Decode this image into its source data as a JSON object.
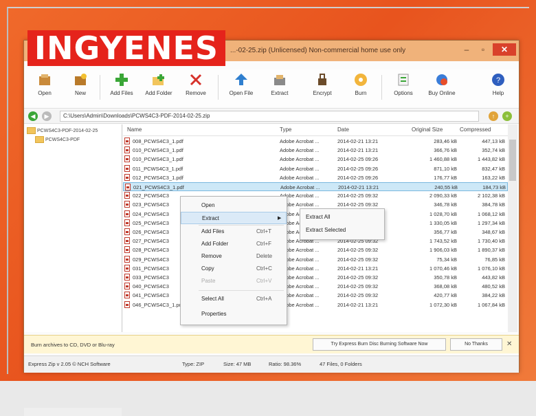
{
  "banner": {
    "text": "INGYENES",
    "color": "#e5231b"
  },
  "window": {
    "title": "...-02-25.zip (Unlicensed) Non-commercial home use only",
    "controls": {
      "minimize": "–",
      "maximize": "▫",
      "close": "✕"
    }
  },
  "toolbar": {
    "buttons": [
      {
        "label": "Open",
        "icon": "open-archive-icon"
      },
      {
        "label": "New",
        "icon": "new-archive-icon"
      },
      {
        "label": "Add Files",
        "icon": "add-files-icon"
      },
      {
        "label": "Add Folder",
        "icon": "add-folder-icon"
      },
      {
        "label": "Remove",
        "icon": "remove-icon"
      },
      {
        "label": "Open File",
        "icon": "open-file-icon"
      },
      {
        "label": "Extract",
        "icon": "extract-icon"
      },
      {
        "label": "Encrypt",
        "icon": "encrypt-icon"
      },
      {
        "label": "Burn",
        "icon": "burn-icon"
      },
      {
        "label": "Options",
        "icon": "options-icon"
      },
      {
        "label": "Buy Online",
        "icon": "buy-online-icon"
      },
      {
        "label": "Help",
        "icon": "help-icon"
      }
    ]
  },
  "address": {
    "path": "C:\\Users\\Admin\\Downloads\\PCWS4C3-PDF-2014-02-25.zip"
  },
  "tree": {
    "items": [
      {
        "label": "PCWS4C3-PDF-2014-02-25"
      },
      {
        "label": "PCWS4C3-PDF"
      }
    ]
  },
  "filelist": {
    "columns": {
      "name": "Name",
      "type": "Type",
      "date": "Date",
      "original": "Original Size",
      "compressed": "Compressed"
    },
    "rows": [
      {
        "name": "008_PCWS4C3_1.pdf",
        "type": "Adobe Acrobat ...",
        "date": "2014-02-21 13:21",
        "original": "283,46 kB",
        "compressed": "447,13 kB"
      },
      {
        "name": "010_PCWS4C3_1.pdf",
        "type": "Adobe Acrobat ...",
        "date": "2014-02-21 13:21",
        "original": "366,76 kB",
        "compressed": "352,74 kB"
      },
      {
        "name": "010_PCWS4C3_1.pdf",
        "type": "Adobe Acrobat ...",
        "date": "2014-02-25 09:26",
        "original": "1 460,88 kB",
        "compressed": "1 443,82 kB"
      },
      {
        "name": "011_PCWS4C3_1.pdf",
        "type": "Adobe Acrobat ...",
        "date": "2014-02-25 09:26",
        "original": "871,10 kB",
        "compressed": "832,47 kB"
      },
      {
        "name": "012_PCWS4C3_1.pdf",
        "type": "Adobe Acrobat ...",
        "date": "2014-02-25 09:26",
        "original": "176,77 kB",
        "compressed": "163,22 kB"
      },
      {
        "name": "021_PCWS4C3_1.pdf",
        "type": "Adobe Acrobat ...",
        "date": "2014-02-21 13:21",
        "original": "240,55 kB",
        "compressed": "184,73 kB",
        "selected": true
      },
      {
        "name": "022_PCWS4C3",
        "type": "Adobe Acrobat ...",
        "date": "2014-02-25 09:32",
        "original": "2 090,33 kB",
        "compressed": "2 102,38 kB"
      },
      {
        "name": "023_PCWS4C3",
        "type": "Adobe Acrobat ...",
        "date": "2014-02-25 09:32",
        "original": "346,78 kB",
        "compressed": "384,78 kB"
      },
      {
        "name": "024_PCWS4C3",
        "type": "Adobe Acrobat ...",
        "date": "2014-02-25 09:32",
        "original": "1 028,70 kB",
        "compressed": "1 068,12 kB"
      },
      {
        "name": "025_PCWS4C3",
        "type": "Adobe Acrobat ...",
        "date": "2014-02-21 13:21",
        "original": "1 330,05 kB",
        "compressed": "1 297,34 kB"
      },
      {
        "name": "026_PCWS4C3",
        "type": "Adobe Acrobat ...",
        "date": "2014-02-25 09:32",
        "original": "356,77 kB",
        "compressed": "348,67 kB"
      },
      {
        "name": "027_PCWS4C3",
        "type": "Adobe Acrobat ...",
        "date": "2014-02-25 09:32",
        "original": "1 743,52 kB",
        "compressed": "1 730,40 kB"
      },
      {
        "name": "028_PCWS4C3",
        "type": "Adobe Acrobat ...",
        "date": "2014-02-25 09:32",
        "original": "1 906,03 kB",
        "compressed": "1 890,37 kB"
      },
      {
        "name": "029_PCWS4C3",
        "type": "Adobe Acrobat ...",
        "date": "2014-02-25 09:32",
        "original": "75,34 kB",
        "compressed": "76,85 kB"
      },
      {
        "name": "031_PCWS4C3",
        "type": "Adobe Acrobat ...",
        "date": "2014-02-21 13:21",
        "original": "1 070,46 kB",
        "compressed": "1 076,10 kB"
      },
      {
        "name": "033_PCWS4C3",
        "type": "Adobe Acrobat ...",
        "date": "2014-02-25 09:32",
        "original": "350,78 kB",
        "compressed": "443,82 kB"
      },
      {
        "name": "040_PCWS4C3",
        "type": "Adobe Acrobat ...",
        "date": "2014-02-25 09:32",
        "original": "368,08 kB",
        "compressed": "480,52 kB"
      },
      {
        "name": "041_PCWS4C3",
        "type": "Adobe Acrobat ...",
        "date": "2014-02-25 09:32",
        "original": "420,77 kB",
        "compressed": "384,22 kB"
      },
      {
        "name": "046_PCWS4C3_1.pdf",
        "type": "Adobe Acrobat ...",
        "date": "2014-02-21 13:21",
        "original": "1 072,30 kB",
        "compressed": "1 067,84 kB"
      }
    ]
  },
  "context_menu": {
    "items": [
      {
        "label": "Open",
        "shortcut": ""
      },
      {
        "label": "Extract",
        "shortcut": "",
        "submenu": true
      },
      {
        "label": "Add Files",
        "shortcut": "Ctrl+T"
      },
      {
        "label": "Add Folder",
        "shortcut": "Ctrl+F"
      },
      {
        "label": "Remove",
        "shortcut": "Delete"
      },
      {
        "label": "Copy",
        "shortcut": "Ctrl+C"
      },
      {
        "label": "Paste",
        "shortcut": "Ctrl+V",
        "disabled": true
      },
      {
        "label": "Select All",
        "shortcut": "Ctrl+A"
      },
      {
        "label": "Properties",
        "shortcut": ""
      }
    ],
    "submenu": [
      {
        "label": "Extract All"
      },
      {
        "label": "Extract Selected"
      }
    ]
  },
  "notice": {
    "text": "Burn archives to CD, DVD or Blu-ray",
    "button1": "Try Express Burn Disc Burning Software Now",
    "button2": "No Thanks",
    "close": "✕"
  },
  "status": {
    "app": "Express Zip v 2.05 © NCH Software",
    "type": "Type: ZIP",
    "size": "Size: 47 MB",
    "ratio": "Ratio: 98.36%",
    "files": "47 Files, 0 Folders"
  }
}
